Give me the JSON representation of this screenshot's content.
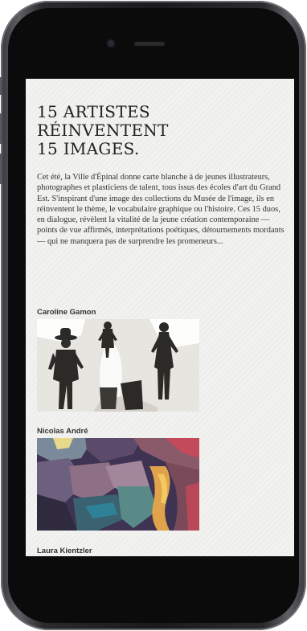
{
  "page": {
    "headline_lines": [
      "15 ARTISTES",
      "RÉINVENTENT",
      "15 IMAGES."
    ],
    "intro": "Cet été, la Ville d'Épinal donne carte blanche à de jeunes illustrateurs, photographes et plasticiens de talent, tous issus des écoles d'art du Grand Est. S'inspirant d'une image des collections du Musée de l'image, ils en réinventent le thème, le vocabulaire graphique ou l'histoire. Ces 15 duos, en dialogue, révèlent la vitalité de la jeune création contemporaine — points de vue affirmés, interprétations poétiques, détournements mordants — qui ne manquera pas de surprendre les promeneurs..."
  },
  "artists": [
    {
      "name": "Caroline Gamon",
      "artwork": "folk-figures-illustration"
    },
    {
      "name": "Nicolas André",
      "artwork": "colorful-landscape-illustration"
    },
    {
      "name": "Laura Kientzler",
      "artwork": ""
    }
  ],
  "colors": {
    "screen_bg": "#f2f2f0",
    "text": "#222222",
    "phone_body": "#1a1a1c"
  }
}
